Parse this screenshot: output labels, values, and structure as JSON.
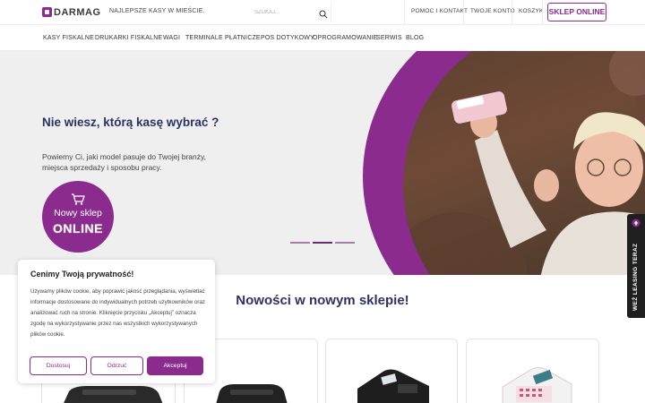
{
  "header": {
    "logo_text": "DARMAG",
    "tagline": "NAJLEPSZE KASY W MIEŚCIE.",
    "search_placeholder": "SZUKAJ...",
    "links": [
      "POMOC I KONTAKT",
      "TWOJE KONTO",
      "KOSZYK"
    ],
    "shop_button": "SKLEP ONLINE"
  },
  "nav": {
    "items": [
      "KASY FISKALNE",
      "DRUKARKI FISKALNE",
      "WAGI",
      "TERMINALE PŁATNICZE",
      "POS DOTYKOWY",
      "OPROGRAMOWANIE",
      "SERWIS",
      "BLOG"
    ]
  },
  "hero": {
    "title": "Nie wiesz, którą kasę wybrać ?",
    "subtitle": "Powiemy Ci, jaki model pasuje do Twojej branży, miejsca sprzedaży i sposobu pracy.",
    "badge_line1": "Nowy sklep",
    "badge_line2": "ONLINE",
    "slides_total": 3,
    "slide_active": 2
  },
  "side_tab": {
    "label": "WEŹ LEASING TERAZ"
  },
  "products": {
    "title": "Nowości w nowym sklepie!"
  },
  "cookie": {
    "title": "Cenimy Twoją prywatność!",
    "text": "Używamy plików cookie, aby poprawić jakość przeglądania, wyświetlać informacje dostosowane do indywidualnych potrzeb użytkowników oraz analizować ruch na stronie. Kliknięcie przycisku „Akceptuj” oznacza zgodę na wykorzystywanie przez nas wszystkich wykorzystywanych plików cookie.",
    "buttons": {
      "customize": "Dostosuj",
      "reject": "Odrzuć",
      "accept": "Akceptuj"
    }
  },
  "colors": {
    "brand": "#8a2b8d",
    "heading": "#2c3264"
  }
}
